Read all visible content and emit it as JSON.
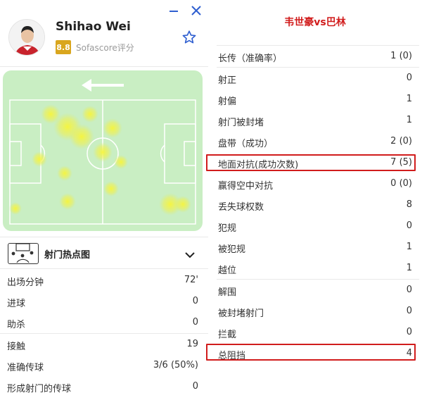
{
  "player": {
    "name": "Shihao Wei",
    "rating": "8.8",
    "rating_label": "Sofascore评分"
  },
  "colors": {
    "accent": "#2f5fd0",
    "rating_bg": "#d9a61e",
    "highlight": "#d11c1c",
    "pitch": "#c9eec3",
    "heat": "#f5f23c"
  },
  "icons": {
    "minimize": "minimize-icon",
    "close": "close-icon",
    "favorite": "star-icon",
    "expand": "chevron-down-icon",
    "shotmap": "shotmap-icon"
  },
  "shotmap": {
    "label": "射门热点图"
  },
  "left_stats": {
    "group1": [
      {
        "label": "出场分钟",
        "value": "72'"
      },
      {
        "label": "进球",
        "value": "0"
      },
      {
        "label": "助杀",
        "value": "0"
      }
    ],
    "group2": [
      {
        "label": "接触",
        "value": "19"
      },
      {
        "label": "准确传球",
        "value": "3/6 (50%)"
      },
      {
        "label": "形成射门的传球",
        "value": "0"
      }
    ]
  },
  "right": {
    "title": "韦世豪vs巴林",
    "group1": [
      {
        "label": "长传（准确率）",
        "value": "1 (0)"
      },
      {
        "label": "射正",
        "value": "0"
      },
      {
        "label": "射偏",
        "value": "1"
      },
      {
        "label": "射门被封堵",
        "value": "1"
      },
      {
        "label": "盘带（成功）",
        "value": "2 (0)"
      },
      {
        "label": "地面对抗(成功次数)",
        "value": "7 (5)",
        "highlight": true
      },
      {
        "label": "赢得空中对抗",
        "value": "0 (0)"
      },
      {
        "label": "丢失球权数",
        "value": "8"
      },
      {
        "label": "犯规",
        "value": "0"
      },
      {
        "label": "被犯规",
        "value": "1"
      },
      {
        "label": "越位",
        "value": "1"
      }
    ],
    "group2": [
      {
        "label": "解围",
        "value": "0"
      },
      {
        "label": "被封堵射门",
        "value": "0"
      },
      {
        "label": "拦截",
        "value": "0"
      },
      {
        "label": "总阻挡",
        "value": "4",
        "highlight": true
      }
    ]
  }
}
